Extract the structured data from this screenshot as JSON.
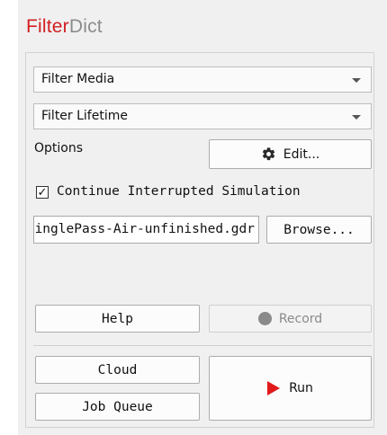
{
  "app": {
    "title_part1": "Filter",
    "title_part2": "Dict"
  },
  "filter_media": {
    "value": "Filter Media"
  },
  "filter_lifetime": {
    "value": "Filter Lifetime"
  },
  "options": {
    "label": "Options",
    "edit_button": "Edit...",
    "edit_icon": "gear-icon"
  },
  "continue_sim": {
    "checked": true,
    "check_glyph": "✓",
    "label": "Continue Interrupted Simulation"
  },
  "file": {
    "path": "e-SinglePass-Air-unfinished.gdr",
    "browse_button": "Browse..."
  },
  "buttons": {
    "help": "Help",
    "record": "Record",
    "cloud": "Cloud",
    "job_queue": "Job Queue",
    "run": "Run"
  },
  "colors": {
    "brand_red": "#d11f22",
    "brand_gray": "#8c8c8c",
    "run_arrow": "#e0191b",
    "record_dot": "#8a8a8a"
  }
}
